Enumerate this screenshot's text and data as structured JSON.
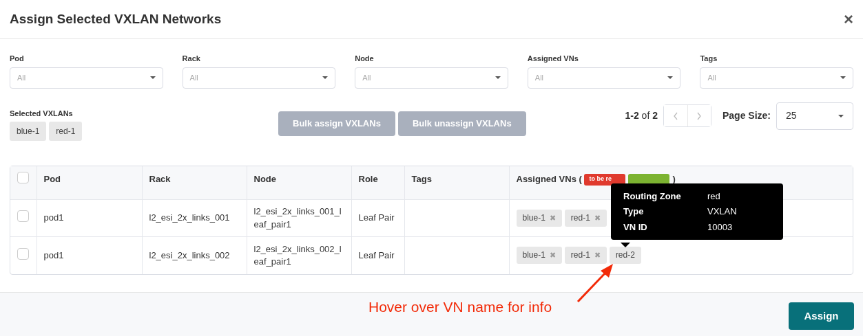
{
  "modal": {
    "title": "Assign Selected VXLAN Networks",
    "close": "×"
  },
  "filters": [
    {
      "label": "Pod",
      "placeholder": "All"
    },
    {
      "label": "Rack",
      "placeholder": "All"
    },
    {
      "label": "Node",
      "placeholder": "All"
    },
    {
      "label": "Assigned VNs",
      "placeholder": "All"
    },
    {
      "label": "Tags",
      "placeholder": "All"
    }
  ],
  "selected_vxlans": {
    "label": "Selected VXLANs",
    "chips": [
      "blue-1",
      "red-1"
    ]
  },
  "bulk_buttons": [
    {
      "label": "Bulk assign VXLANs",
      "disabled": true
    },
    {
      "label": "Bulk unassign VXLANs",
      "disabled": true
    }
  ],
  "pagination": {
    "range": "1-2",
    "of": "of 2",
    "prev_disabled": true,
    "next_disabled": true
  },
  "page_size": {
    "label": "Page Size:",
    "value": "25"
  },
  "table": {
    "columns": [
      "Pod",
      "Rack",
      "Node",
      "Role",
      "Tags"
    ],
    "vn_column": {
      "label": "Assigned VNs (",
      "legend": [
        {
          "label": "to be re",
          "color": "#e03a2e"
        },
        {
          "color": "#7cb331"
        }
      ],
      "close": ")"
    },
    "header_checked": false,
    "rows": [
      {
        "checked": false,
        "cells": [
          "pod1",
          "l2_esi_2x_links_001",
          "l2_esi_2x_links_001_leaf_pair1",
          "Leaf Pair",
          ""
        ],
        "vns": [
          {
            "name": "blue-1",
            "remove": "✖"
          },
          {
            "name": "red-1",
            "remove": "✖"
          }
        ]
      },
      {
        "checked": false,
        "cells": [
          "pod1",
          "l2_esi_2x_links_002",
          "l2_esi_2x_links_002_leaf_pair1",
          "Leaf Pair",
          ""
        ],
        "vns": [
          {
            "name": "blue-1",
            "remove": "✖"
          },
          {
            "name": "red-1",
            "remove": "✖"
          },
          {
            "name": "red-2"
          }
        ]
      }
    ]
  },
  "tooltip": {
    "rows": [
      {
        "key": "Routing Zone",
        "value": "red"
      },
      {
        "key": "Type",
        "value": "VXLAN"
      },
      {
        "key": "VN ID",
        "value": "10003"
      }
    ]
  },
  "annotation": "Hover over VN name for info",
  "footer": {
    "button": "Assign"
  }
}
